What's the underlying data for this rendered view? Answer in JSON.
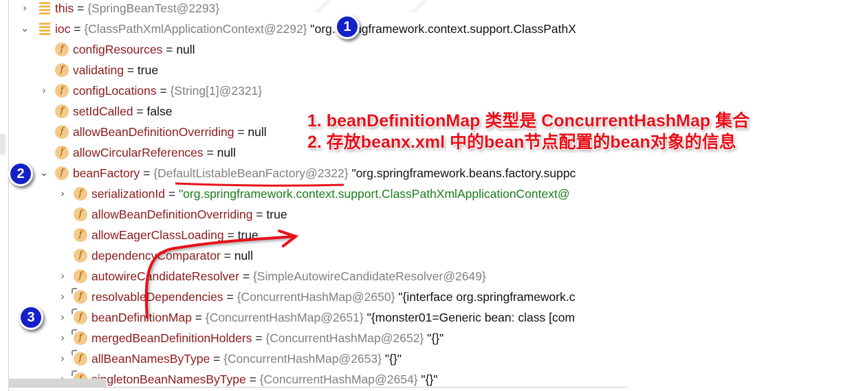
{
  "rows": [
    {
      "level": 0,
      "expand": "collapsed",
      "icon": "stack",
      "name": "this",
      "eq": " = ",
      "ref": "{SpringBeanTest@2293}",
      "str": ""
    },
    {
      "level": 0,
      "expand": "expanded",
      "icon": "stack",
      "name": "ioc",
      "eq": " = ",
      "ref": "{ClassPathXmlApplicationContext@2292}",
      "str": " \"org.springframework.context.support.ClassPathX"
    },
    {
      "level": 1,
      "expand": "none",
      "icon": "field",
      "name": "configResources",
      "eq": " = ",
      "ref": "",
      "str": "null"
    },
    {
      "level": 1,
      "expand": "none",
      "icon": "field",
      "name": "validating",
      "eq": " = ",
      "ref": "",
      "str": "true"
    },
    {
      "level": 1,
      "expand": "collapsed",
      "icon": "field",
      "name": "configLocations",
      "eq": " = ",
      "ref": "{String[1]@2321}",
      "str": ""
    },
    {
      "level": 1,
      "expand": "none",
      "icon": "field",
      "name": "setIdCalled",
      "eq": " = ",
      "ref": "",
      "str": "false"
    },
    {
      "level": 1,
      "expand": "none",
      "icon": "field",
      "name": "allowBeanDefinitionOverriding",
      "eq": " = ",
      "ref": "",
      "str": "null"
    },
    {
      "level": 1,
      "expand": "none",
      "icon": "field",
      "name": "allowCircularReferences",
      "eq": " = ",
      "ref": "",
      "str": "null"
    },
    {
      "level": 1,
      "expand": "expanded",
      "icon": "field",
      "name": "beanFactory",
      "eq": " = ",
      "ref": "{DefaultListableBeanFactory@2322}",
      "str": " \"org.springframework.beans.factory.suppc"
    },
    {
      "level": 2,
      "expand": "collapsed",
      "icon": "field",
      "name": "serializationId",
      "eq": " = ",
      "ref": "",
      "green": "\"org.springframework.context.support.ClassPathXmlApplicationContext@"
    },
    {
      "level": 2,
      "expand": "none",
      "icon": "field",
      "name": "allowBeanDefinitionOverriding",
      "eq": " = ",
      "ref": "",
      "str": "true"
    },
    {
      "level": 2,
      "expand": "none",
      "icon": "field",
      "name": "allowEagerClassLoading",
      "eq": " = ",
      "ref": "",
      "str": "true"
    },
    {
      "level": 2,
      "expand": "none",
      "icon": "field",
      "name": "dependencyComparator",
      "eq": " = ",
      "ref": "",
      "str": "null"
    },
    {
      "level": 2,
      "expand": "collapsed",
      "icon": "field",
      "name": "autowireCandidateResolver",
      "eq": " = ",
      "ref": "{SimpleAutowireCandidateResolver@2649}",
      "str": ""
    },
    {
      "level": 2,
      "expand": "collapsed",
      "icon": "field-final",
      "name": "resolvableDependencies",
      "eq": " = ",
      "ref": "{ConcurrentHashMap@2650}",
      "str": " \"{interface org.springframework.c"
    },
    {
      "level": 2,
      "expand": "collapsed",
      "icon": "field-final",
      "name": "beanDefinitionMap",
      "eq": " = ",
      "ref": "{ConcurrentHashMap@2651}",
      "str": " \"{monster01=Generic bean: class [com"
    },
    {
      "level": 2,
      "expand": "collapsed",
      "icon": "field-final",
      "name": "mergedBeanDefinitionHolders",
      "eq": " = ",
      "ref": "{ConcurrentHashMap@2652}",
      "str": " \"{}\""
    },
    {
      "level": 2,
      "expand": "collapsed",
      "icon": "field-final",
      "name": "allBeanNamesByType",
      "eq": " = ",
      "ref": "{ConcurrentHashMap@2653}",
      "str": " \"{}\""
    },
    {
      "level": 2,
      "expand": "collapsed",
      "icon": "field-final",
      "name": "singletonBeanNamesByType",
      "eq": " = ",
      "ref": "{ConcurrentHashMap@2654}",
      "str": " \"{}\""
    }
  ],
  "annotations": {
    "badges": [
      "1",
      "2",
      "3"
    ],
    "note_line1": "1. beanDefinitionMap 类型是 ConcurrentHashMap 集合",
    "note_line2": "2. 存放beanx.xml 中的bean节点配置的bean对象的信息",
    "badge_color": "#1420c8",
    "note_color": "#e8101a"
  },
  "icons": {
    "field": "f",
    "stack": "stack-frame-icon",
    "expanded": "chevron-down-icon",
    "collapsed": "chevron-right-icon"
  }
}
